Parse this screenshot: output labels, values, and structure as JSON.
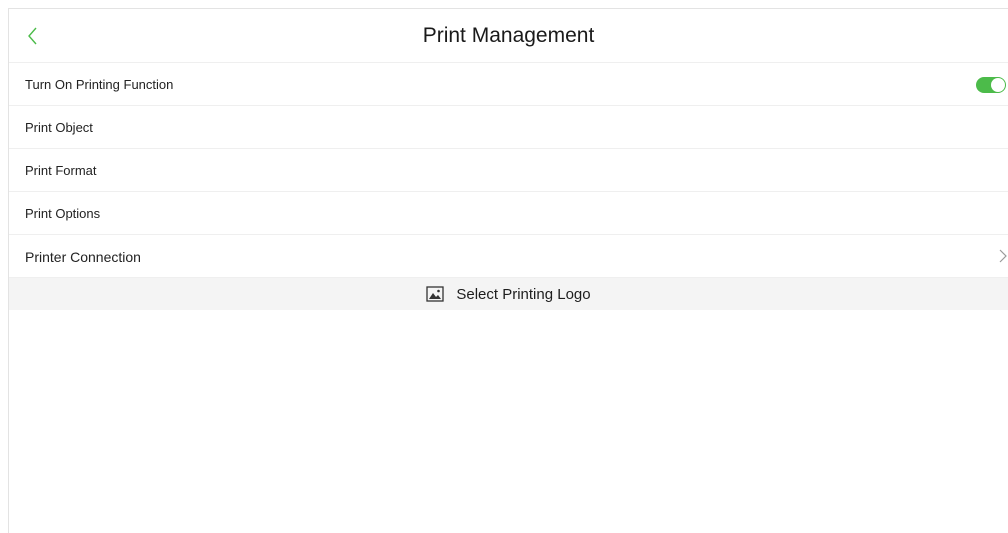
{
  "header": {
    "title": "Print Management",
    "back_icon": "chevron-left-icon"
  },
  "settings": [
    {
      "label": "Turn On Printing Function",
      "control": "toggle",
      "value": "on"
    },
    {
      "label": "Print Object"
    },
    {
      "label": "Print Format"
    },
    {
      "label": "Print Options"
    },
    {
      "label": "Printer Connection",
      "control": "chevron-right-icon"
    }
  ],
  "logo_action": {
    "label": "Select Printing Logo",
    "icon": "image-icon"
  },
  "colors": {
    "accent": "#4cbb4a",
    "logo_bar_bg": "#f4f4f4",
    "divider": "#efefef"
  }
}
